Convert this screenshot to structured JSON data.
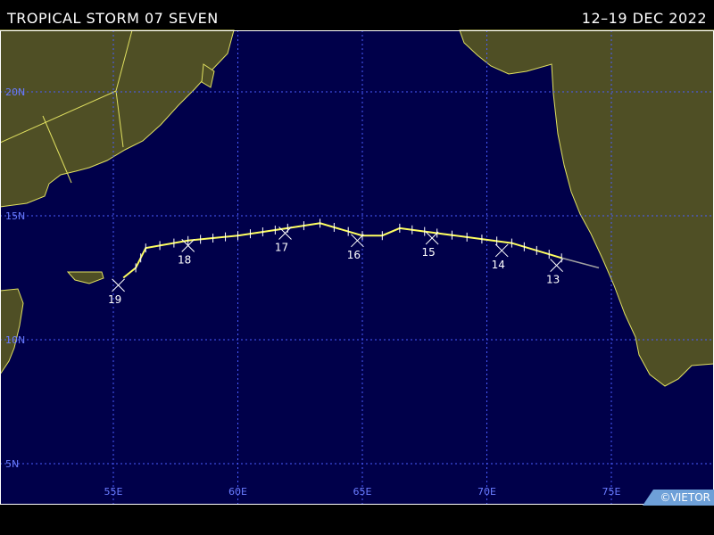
{
  "header": {
    "storm_title": "TROPICAL STORM 07 SEVEN",
    "date_range": "12–19 DEC 2022"
  },
  "credit": "©VIETOR",
  "colors": {
    "ocean": "#00004a",
    "land": "#4f4f25",
    "coast": "#e0e060",
    "grid": "#4a5cff",
    "grid_label": "#6a7cff",
    "track": "#ffff60",
    "track_weak": "#a0a0a0"
  },
  "map": {
    "lat_labels": [
      "20N",
      "15N",
      "10N",
      "5N"
    ],
    "lon_labels": [
      "55E",
      "60E",
      "65E",
      "70E",
      "75E"
    ]
  },
  "track": {
    "points": [
      {
        "lon": 74.5,
        "lat": 12.9
      },
      {
        "lon": 73.0,
        "lat": 13.3
      },
      {
        "lon": 71.0,
        "lat": 13.9
      },
      {
        "lon": 68.0,
        "lat": 14.3
      },
      {
        "lon": 66.5,
        "lat": 14.5
      },
      {
        "lon": 65.8,
        "lat": 14.2
      },
      {
        "lon": 65.0,
        "lat": 14.2
      },
      {
        "lon": 63.3,
        "lat": 14.7
      },
      {
        "lon": 62.0,
        "lat": 14.5
      },
      {
        "lon": 60.0,
        "lat": 14.2
      },
      {
        "lon": 58.0,
        "lat": 14.0
      },
      {
        "lon": 56.3,
        "lat": 13.7
      },
      {
        "lon": 55.9,
        "lat": 12.9
      },
      {
        "lon": 55.4,
        "lat": 12.5
      }
    ],
    "day_labels": [
      {
        "text": "13",
        "lon": 72.8,
        "lat": 13.0
      },
      {
        "text": "14",
        "lon": 70.6,
        "lat": 13.6
      },
      {
        "text": "15",
        "lon": 67.8,
        "lat": 14.1
      },
      {
        "text": "16",
        "lon": 64.8,
        "lat": 14.0
      },
      {
        "text": "17",
        "lon": 61.9,
        "lat": 14.3
      },
      {
        "text": "18",
        "lon": 58.0,
        "lat": 13.8
      },
      {
        "text": "19",
        "lon": 55.2,
        "lat": 12.2
      }
    ]
  }
}
